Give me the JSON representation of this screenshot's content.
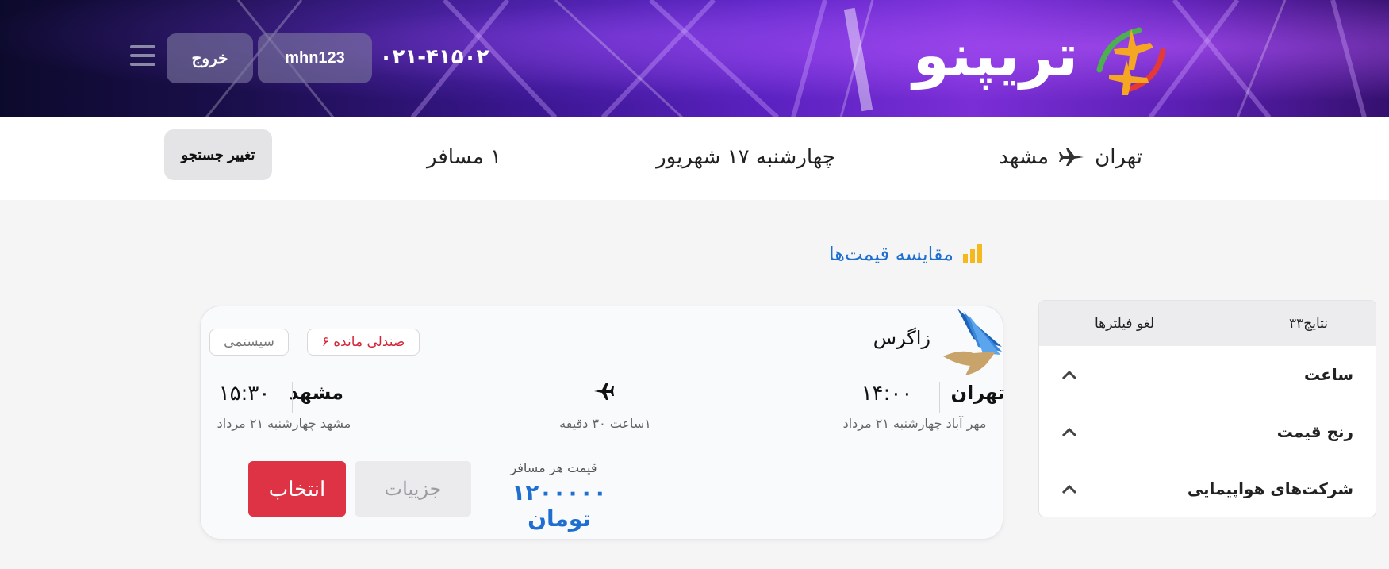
{
  "header": {
    "logo_text": "تریپنو",
    "phone": "۰۲۱-۴۱۵۰۲",
    "username": "mhn123",
    "logout_label": "خروج"
  },
  "search": {
    "origin": "تهران",
    "destination": "مشهد",
    "date": "چهارشنبه ۱۷ شهریور",
    "passengers": "۱ مسافر",
    "change_label": "تغییر جستجو"
  },
  "compare_label": "مقایسه قیمت‌ها",
  "filters": {
    "results_label": "نتایج۳۳",
    "clear_label": "لغو فیلترها",
    "items": [
      {
        "label": "ساعت"
      },
      {
        "label": "رنج قیمت"
      },
      {
        "label": "شرکت‌های هواپیمایی"
      }
    ]
  },
  "flight": {
    "airline": "زاگرس",
    "seats_left": "۶ صندلی مانده",
    "ticket_type": "سیستمی",
    "departure": {
      "city": "تهران",
      "time": "۱۴:۰۰",
      "detail": "مهر آباد چهارشنبه ۲۱ مرداد"
    },
    "arrival": {
      "city": "مشهد",
      "time": "۱۵:۳۰",
      "detail": "مشهد چهارشنبه ۲۱ مرداد"
    },
    "duration": "۱ساعت ۳۰ دقیقه",
    "price_label": "قیمت هر مسافر",
    "price": "۱۲۰۰۰۰۰ تومان",
    "details_label": "جزییات",
    "select_label": "انتخاب"
  },
  "colors": {
    "accent_blue": "#1f6fd0",
    "select_red": "#dd3345",
    "seats_red": "#d3263b"
  }
}
